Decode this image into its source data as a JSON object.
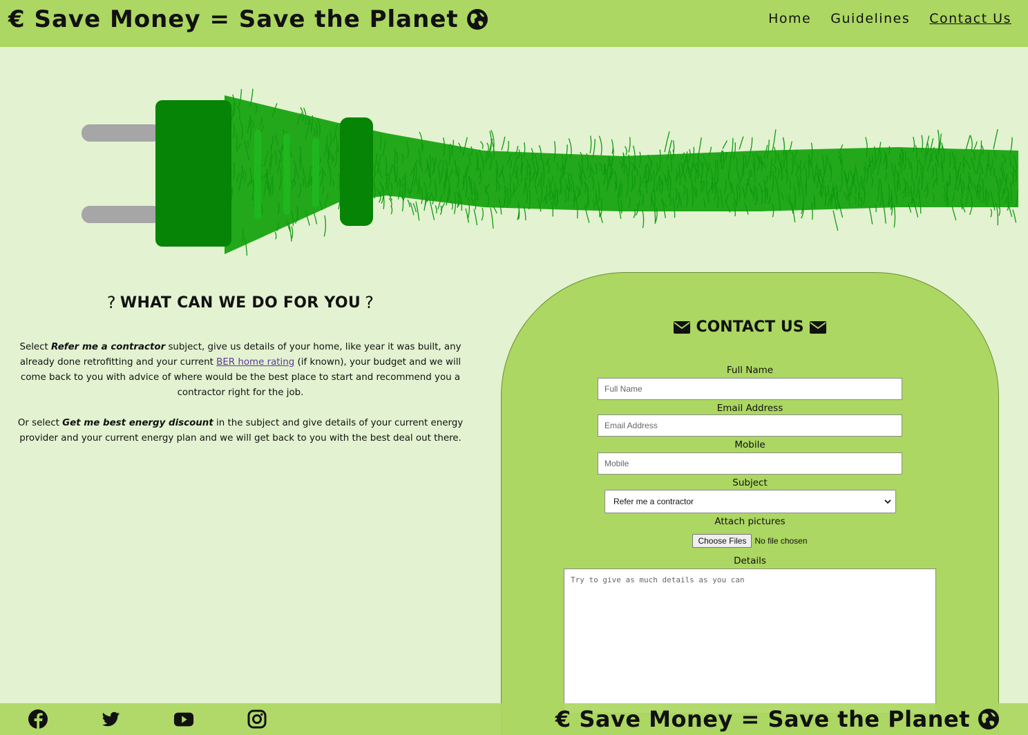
{
  "header": {
    "brand": "€ Save Money = Save the Planet",
    "nav": [
      {
        "label": "Home"
      },
      {
        "label": "Guidelines"
      },
      {
        "label": "Contact Us"
      }
    ]
  },
  "hero": {
    "icon": "green-plug-icon"
  },
  "info": {
    "title": "WHAT CAN WE DO FOR YOU",
    "p1_a": "Select ",
    "p1_b": "Refer me a contractor",
    "p1_c": " subject, give us details of your home, like year it was built, any already done retrofitting and your current ",
    "p1_link": "BER home rating",
    "p1_d": " (if known), your budget and we will come back to you with advice of where would be the best place to start and recommend you a contractor right for the job.",
    "p2_a": "Or select ",
    "p2_b": "Get me best energy discount",
    "p2_c": " in the subject and give details of your current energy provider and your current energy plan and we will get back to you with the best deal out there."
  },
  "contact": {
    "title": "CONTACT US",
    "full_name_label": "Full Name",
    "full_name_placeholder": "Full Name",
    "email_label": "Email Address",
    "email_placeholder": "Email Address",
    "mobile_label": "Mobile",
    "mobile_placeholder": "Mobile",
    "subject_label": "Subject",
    "subject_value": "Refer me a contractor",
    "attach_label": "Attach pictures",
    "file_button": "Choose Files",
    "file_status": "No file chosen",
    "details_label": "Details",
    "details_placeholder": "Try to give as much details as you can"
  },
  "footer": {
    "social": [
      "facebook-icon",
      "twitter-icon",
      "youtube-icon",
      "instagram-icon"
    ],
    "brand": "€ Save Money = Save the Planet"
  },
  "colors": {
    "header_bg": "#acd762",
    "page_bg": "#e3f2d0",
    "plug_green": "#0a8a0a"
  }
}
